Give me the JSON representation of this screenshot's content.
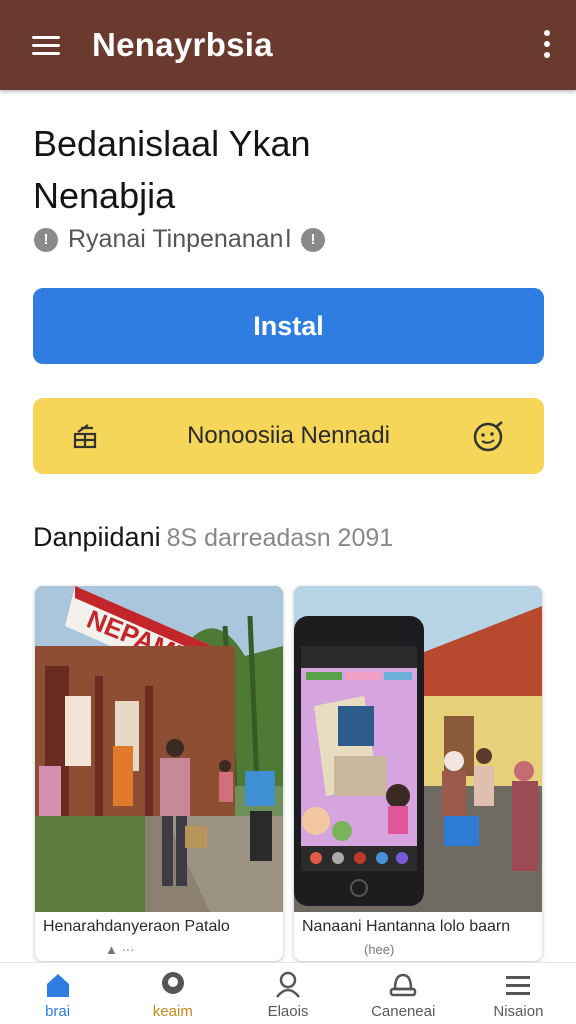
{
  "appbar": {
    "title": "Nenayrbsia",
    "menu_icon": "hamburger-icon",
    "more_icon": "more-vert-icon",
    "color": "#6a3a2e"
  },
  "app": {
    "title_line1": "Bedanislaal Ykan",
    "title_line2": "Nenabjia",
    "developer": "Ryanai Tinpenanan",
    "developer_badge": "l"
  },
  "actions": {
    "install_label": "Instal",
    "install_color": "#2f7de0",
    "secondary_label": "Nonoosiia Nennadi",
    "secondary_color": "#f6d659"
  },
  "screenshots_section": {
    "title": "Danpiidani",
    "subtitle": "8S darreadasn 2091",
    "cards": [
      {
        "caption": "Henarahdanyeraon Patalo",
        "meta": "▲ ···"
      },
      {
        "caption": "Nanaani Hantanna lolo baarn",
        "meta": "(hee)"
      }
    ]
  },
  "bottom_nav": {
    "items": [
      {
        "label": "brai",
        "icon": "home-icon"
      },
      {
        "label": "keaim",
        "icon": "pin-icon"
      },
      {
        "label": "Elaois",
        "icon": "person-icon"
      },
      {
        "label": "Caneneai",
        "icon": "account-icon"
      },
      {
        "label": "Nisaion",
        "icon": "menu-icon"
      }
    ]
  }
}
